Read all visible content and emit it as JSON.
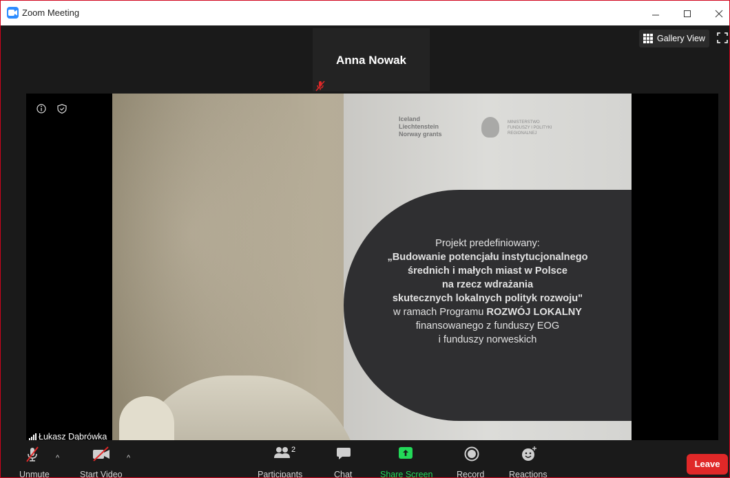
{
  "window": {
    "title": "Zoom Meeting"
  },
  "active_speaker": {
    "name": "Anna Nowak"
  },
  "view_controls": {
    "gallery_label": "Gallery View"
  },
  "main_video": {
    "participant_name": "Łukasz Dąbrówka",
    "poster": {
      "logo_lines": [
        "Iceland",
        "Liechtenstein",
        "Norway grants"
      ],
      "ministry_lines": [
        "MINISTERSTWO",
        "FUNDUSZY I POLITYKI",
        "REGIONALNEJ"
      ],
      "banner_lines": [
        "Projekt predefiniowany:",
        "„Budowanie potencjału instytucjonalnego",
        "średnich i małych miast w Polsce",
        "na rzecz wdrażania",
        "skutecznych lokalnych polityk rozwoju\"",
        "w ramach Programu",
        "ROZWÓJ LOKALNY",
        "finansowanego z funduszy EOG",
        "i funduszy norweskich"
      ]
    }
  },
  "toolbar": {
    "unmute_label": "Unmute",
    "start_video_label": "Start Video",
    "participants_label": "Participants",
    "participants_count": "2",
    "chat_label": "Chat",
    "share_screen_label": "Share Screen",
    "record_label": "Record",
    "reactions_label": "Reactions",
    "leave_label": "Leave"
  },
  "colors": {
    "accent_blue": "#2d8cff",
    "share_green": "#23d959",
    "leave_red": "#e02828",
    "mute_red": "#e02828"
  }
}
